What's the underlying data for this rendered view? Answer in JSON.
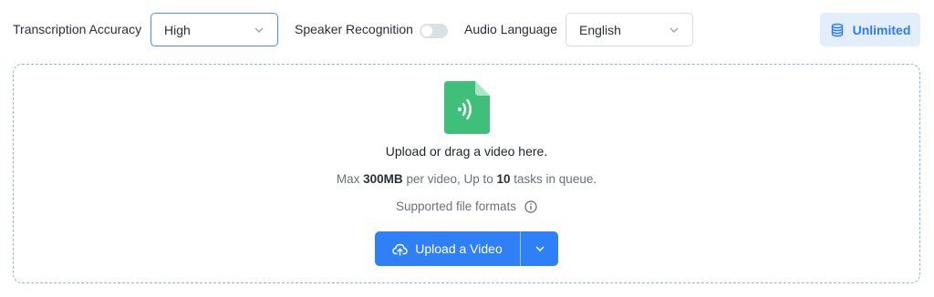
{
  "settings": {
    "accuracy_label": "Transcription Accuracy",
    "accuracy_value": "High",
    "speaker_label": "Speaker Recognition",
    "speaker_enabled": false,
    "language_label": "Audio Language",
    "language_value": "English"
  },
  "plan": {
    "label": "Unlimited",
    "icon": "database-icon"
  },
  "upload": {
    "title": "Upload or drag a video here.",
    "limits": {
      "prefix": "Max ",
      "size": "300MB",
      "middle": " per video, Up to ",
      "tasks": "10",
      "suffix": " tasks in queue."
    },
    "formats_label": "Supported file formats",
    "button_label": "Upload a Video"
  },
  "colors": {
    "accent": "#2f80f7",
    "file_icon": "#3fc07a",
    "badge_bg": "#e3eefc",
    "dashed_border": "#8db3ef"
  }
}
